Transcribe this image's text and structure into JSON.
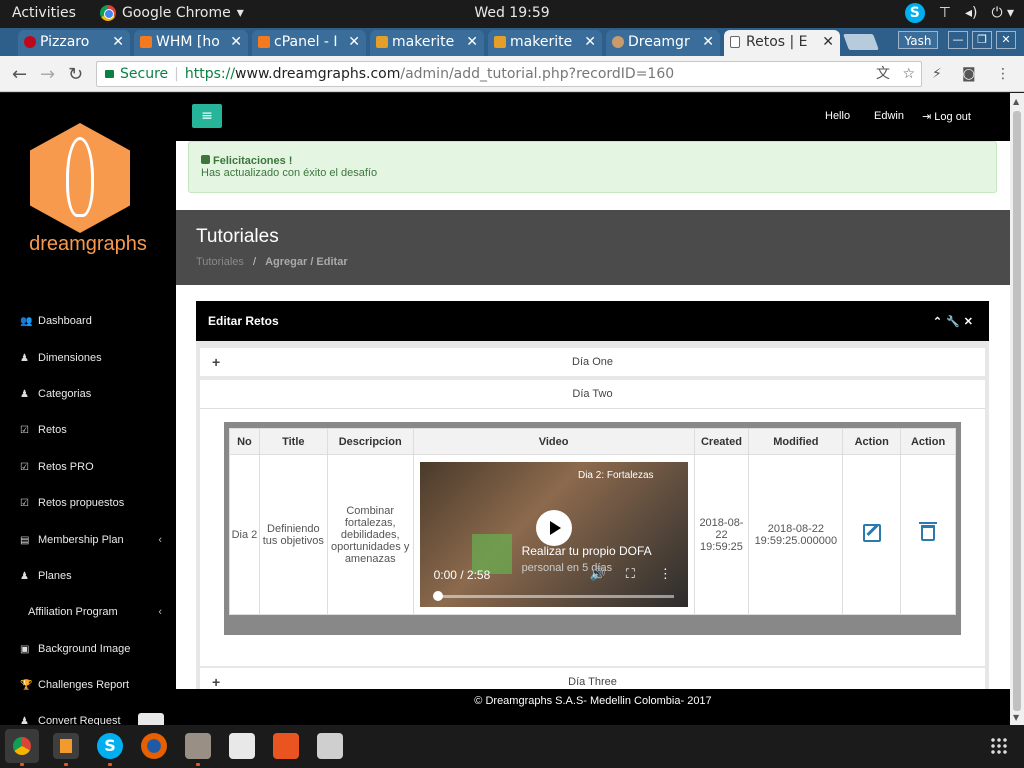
{
  "topbar": {
    "activities": "Activities",
    "app_name": "Google Chrome",
    "clock": "Wed 19:59",
    "skype": "S",
    "tray_icons": [
      "network-icon",
      "volume-icon",
      "power-icon"
    ]
  },
  "tabs": [
    {
      "label": "Pizzaro",
      "icon": "pinterest-icon"
    },
    {
      "label": "WHM [ho",
      "icon": "cpanel-icon"
    },
    {
      "label": "cPanel - I",
      "icon": "cpanel-icon"
    },
    {
      "label": "makerite",
      "icon": "pma-icon"
    },
    {
      "label": "makerite",
      "icon": "pma-icon"
    },
    {
      "label": "Dreamgr",
      "icon": "dreamgraphs-icon"
    },
    {
      "label": "Retos | E",
      "icon": "page-icon",
      "active": true
    }
  ],
  "window": {
    "user": "Yash"
  },
  "omnibox": {
    "secure": "Secure",
    "scheme": "https://",
    "host": "www.dreamgraphs.com",
    "path": "/admin/add_tutorial.php?recordID=160"
  },
  "sidebar": {
    "logo_text": "dreamgraphs",
    "items": [
      {
        "label": "Dashboard",
        "icon": "users-icon"
      },
      {
        "label": "Dimensiones",
        "icon": "user-icon"
      },
      {
        "label": "Categorias",
        "icon": "user-icon"
      },
      {
        "label": "Retos",
        "icon": "check-square-icon"
      },
      {
        "label": "Retos PRO",
        "icon": "check-square-icon"
      },
      {
        "label": "Retos propuestos",
        "icon": "check-square-icon"
      },
      {
        "label": "Membership Plan",
        "icon": "document-icon",
        "chevron": true
      },
      {
        "label": "Planes",
        "icon": "user-icon"
      },
      {
        "label": "Affiliation Program",
        "icon": "",
        "chevron": true
      },
      {
        "label": "Background Image",
        "icon": "image-icon"
      },
      {
        "label": "Challenges Report",
        "icon": "trophy-icon"
      },
      {
        "label": "Convert Request",
        "icon": "user-icon"
      }
    ]
  },
  "header": {
    "hello": "Hello",
    "user": "Edwin",
    "logout": "Log out"
  },
  "alert": {
    "title": "Felicitaciones !",
    "message": "Has actualizado con éxito el desafío"
  },
  "page": {
    "title": "Tutoriales",
    "crumb_root": "Tutoriales",
    "crumb_sep": "/",
    "crumb_current": "Agregar / Editar"
  },
  "panel": {
    "title": "Editar Retos",
    "sections": [
      {
        "label": "Día One",
        "expanded": false
      },
      {
        "label": "Día Two",
        "expanded": true
      },
      {
        "label": "Día Three",
        "expanded": false
      }
    ],
    "table": {
      "headers": [
        "No",
        "Title",
        "Descripcion",
        "Video",
        "Created",
        "Modified",
        "Action",
        "Action"
      ],
      "row": {
        "no": "Dia 2",
        "title": "Definiendo tus objetivos",
        "descripcion": "Combinar fortalezas, debilidades, oportunidades y amenazas",
        "video": {
          "overlay_title": "Dia 2: Fortalezas",
          "caption_1": "Realizar tu propio DOFA",
          "caption_2": "personal en 5 días",
          "time": "0:00 / 2:58"
        },
        "created": "2018-08-22 19:59:25",
        "modified": "2018-08-22 19:59:25.000000"
      }
    }
  },
  "footer": {
    "text": "© Dreamgraphs S.A.S- Medellin Colombia- 2017"
  },
  "colors": {
    "accent_green": "#26b599",
    "logo_orange": "#f79a4e",
    "tab_blue": "#2d5f8a",
    "action_blue": "#2a7ab0"
  },
  "dock": [
    "chrome-icon",
    "sublime-icon",
    "skype-icon",
    "firefox-icon",
    "files-icon",
    "document-viewer-icon",
    "software-center-icon",
    "camera-icon"
  ]
}
